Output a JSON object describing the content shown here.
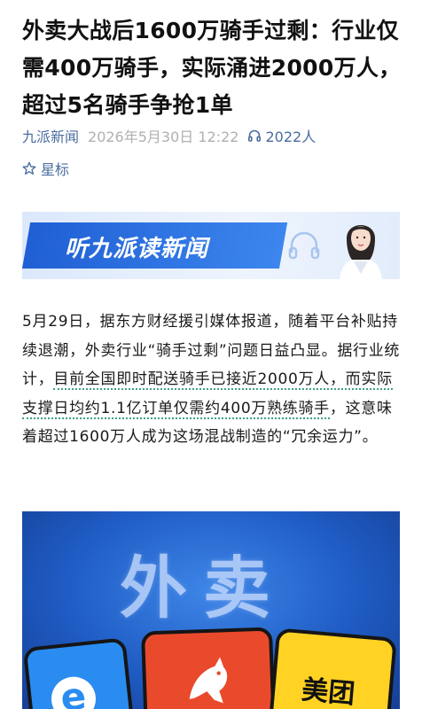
{
  "article": {
    "title": "外卖大战后1600万骑手过剩：行业仅需400万骑手，实际涌进2000万人，超过5名骑手争抢1单",
    "source": "九派新闻",
    "datetime": "2026年5月30日 12:22",
    "listen_count": "2022人",
    "star_label": "星标"
  },
  "banner": {
    "text": "听九派读新闻",
    "icons": [
      "headphones-icon",
      "news-anchor-avatar"
    ]
  },
  "body": {
    "p1_a": "5月29日，据东方财经援引媒体报道，随着平台补贴持续退潮，外卖行业“骑手过剩”问题日益凸显。据行业统计，",
    "p1_highlight": "目前全国即时配送骑手已接近2000万人，而实际支撑日均约1.1亿订单仅需约400万熟练骑手",
    "p1_b": "，这意味着超过1600万人成为这场混战制造的“冗余运力”。"
  },
  "hero": {
    "text": "外卖",
    "app_e_glyph": "e",
    "meituan_text": "美团",
    "colors": {
      "eleme": "#2a8cf0",
      "taobao": "#ea4a2c",
      "meituan": "#ffd223",
      "bg": "#1f5cc4"
    }
  },
  "colors": {
    "accent": "#4a6da0",
    "muted": "#b0b0b0",
    "highlight_underline": "#3fa08a"
  }
}
